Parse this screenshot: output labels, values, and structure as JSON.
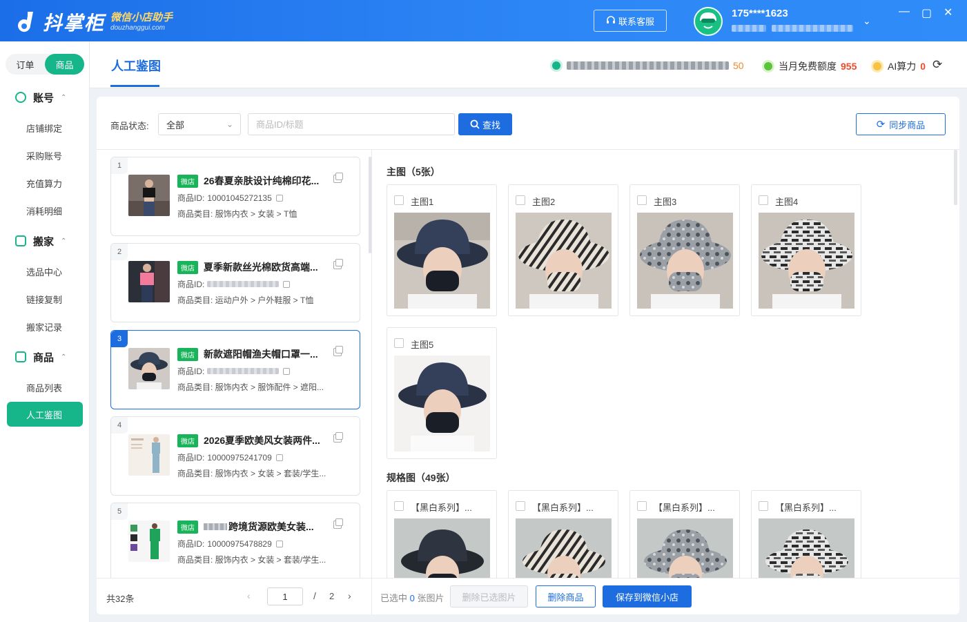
{
  "header": {
    "logo_name": "抖掌柜",
    "logo_tagline": "微信小店助手",
    "logo_domain": "douzhanggui.com",
    "support_label": "联系客服",
    "phone": "175****1623"
  },
  "sidebar": {
    "seg_orders": "订单",
    "seg_products": "商品",
    "group_account": "账号",
    "account_items": [
      "店铺绑定",
      "采购账号",
      "充值算力",
      "消耗明细"
    ],
    "group_move": "搬家",
    "move_items": [
      "选品中心",
      "链接复制",
      "搬家记录"
    ],
    "group_goods": "商品",
    "goods_items": [
      "商品列表",
      "人工鉴图"
    ]
  },
  "topbar": {
    "page_tab": "人工鉴图",
    "quota_value_1": "50",
    "quota_label_2": "当月免费额度",
    "quota_value_2": "955",
    "quota_label_3": "AI算力",
    "quota_value_3": "0"
  },
  "filter": {
    "status_label": "商品状态:",
    "status_value": "全部",
    "search_placeholder": "商品ID/标题",
    "search_btn": "查找",
    "sync_btn": "同步商品"
  },
  "products": [
    {
      "index": "1",
      "tag": "微店",
      "title": "26春夏亲肤设计纯棉印花...",
      "id_label": "商品ID:",
      "id": "10001045272135",
      "category": "商品类目: 服饰内衣 > 女装 > T恤"
    },
    {
      "index": "2",
      "tag": "微店",
      "title": "夏季新款丝光棉欧货高端...",
      "id_label": "商品ID:",
      "id": "",
      "category": "商品类目: 运动户外 > 户外鞋服 > T恤"
    },
    {
      "index": "3",
      "tag": "微店",
      "title": "新款遮阳帽渔夫帽口罩一...",
      "id_label": "商品ID:",
      "id": "",
      "category": "商品类目: 服饰内衣 > 服饰配件 > 遮阳..."
    },
    {
      "index": "4",
      "tag": "微店",
      "title": "2026夏季欧美风女装两件...",
      "id_label": "商品ID:",
      "id": "10000975241709",
      "category": "商品类目: 服饰内衣 > 女装 > 套装/学生..."
    },
    {
      "index": "5",
      "tag": "微店",
      "title": "跨境货源欧美女装...",
      "id_label": "商品ID:",
      "id": "10000975478829",
      "category": "商品类目: 服饰内衣 > 女装 > 套装/学生..."
    }
  ],
  "images": {
    "main_title": "主图（5张）",
    "main": [
      "主图1",
      "主图2",
      "主图3",
      "主图4",
      "主图5"
    ],
    "spec_title": "规格图（49张）",
    "spec": [
      "【黑白系列】...",
      "【黑白系列】...",
      "【黑白系列】...",
      "【黑白系列】..."
    ]
  },
  "footer": {
    "total": "共32条",
    "page_current": "1",
    "page_slash": "/",
    "page_total": "2",
    "selected_prefix": "已选中",
    "selected_count": "0",
    "selected_suffix": "张图片",
    "delete_images_btn": "删除已选图片",
    "delete_product_btn": "删除商品",
    "save_btn": "保存到微信小店"
  },
  "colors": {
    "primary": "#1d6de0",
    "accent_green": "#17b58a",
    "wechat_tag": "#18b459",
    "quota_red": "#f04b2a"
  }
}
